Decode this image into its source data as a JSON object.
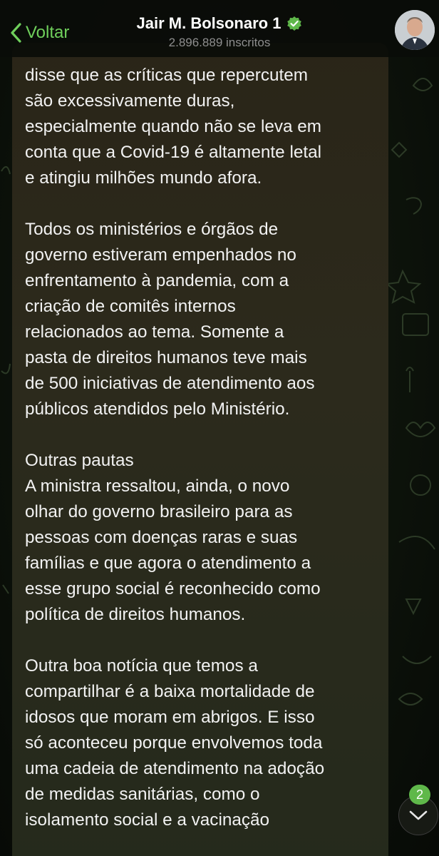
{
  "header": {
    "back_label": "Voltar",
    "channel_name": "Jair M. Bolsonaro 1",
    "subscribers": "2.896.889 inscritos"
  },
  "message": {
    "paragraphs": [
      "disse que as críticas que repercutem\nsão excessivamente duras,\nespecialmente quando não se leva em\nconta que a Covid-19 é altamente letal\ne atingiu milhões mundo afora.",
      "Todos os ministérios e órgãos de\ngoverno estiveram empenhados no\nenfrentamento à pandemia, com a\ncriação de comitês internos\nrelacionados ao tema. Somente a\npasta de direitos humanos teve mais\nde 500 iniciativas de atendimento aos\npúblicos atendidos pelo Ministério.",
      "Outras pautas\nA ministra ressaltou, ainda, o novo\nolhar do governo brasileiro para as\npessoas com doenças raras e suas\nfamílias e que agora o atendimento a\nesse grupo social é reconhecido como\npolítica de direitos humanos.",
      "Outra boa notícia que temos a\ncompartilhar é a baixa mortalidade de\nidosos que moram em abrigos. E isso\nsó aconteceu porque envolvemos toda\numa cadeia de atendimento na adoção\nde medidas sanitárias, como o\nisolamento social e a vacinação"
    ]
  },
  "unread_count": "2",
  "colors": {
    "accent": "#6fcf5b",
    "verified": "#5fb84a",
    "text": "#f2f2f2",
    "subtitle": "#8e8e8e"
  },
  "icons": {
    "back": "chevron-left-icon",
    "verified": "verified-check-icon",
    "scroll": "chevron-down-icon"
  }
}
